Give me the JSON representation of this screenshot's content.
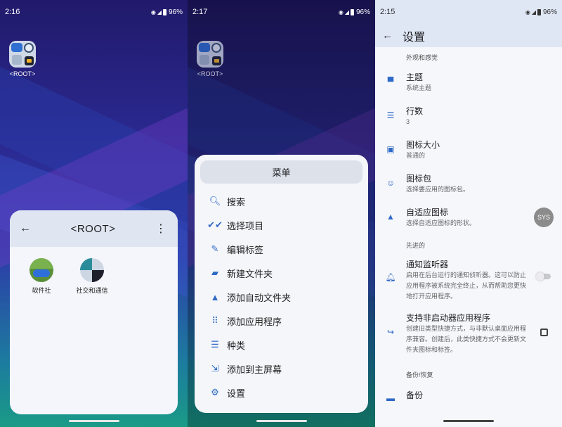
{
  "screens": [
    {
      "status": {
        "time": "2:16",
        "battery": "96%"
      },
      "desktop_app": {
        "label": "<ROOT>"
      },
      "folder": {
        "title": "<ROOT>",
        "apps": [
          {
            "label": "软件社"
          },
          {
            "label": "社交和通信"
          }
        ]
      }
    },
    {
      "status": {
        "time": "2:17",
        "battery": "96%"
      },
      "desktop_app": {
        "label": "<ROOT>"
      },
      "menu": {
        "header": "菜单",
        "items": [
          {
            "label": "搜索",
            "icon": "search-icon"
          },
          {
            "label": "选择项目",
            "icon": "double-check-icon"
          },
          {
            "label": "编辑标签",
            "icon": "pencil-icon"
          },
          {
            "label": "新建文件夹",
            "icon": "new-folder-icon"
          },
          {
            "label": "添加自动文件夹",
            "icon": "shapes-icon"
          },
          {
            "label": "添加应用程序",
            "icon": "grid-icon"
          },
          {
            "label": "种类",
            "icon": "sort-icon"
          },
          {
            "label": "添加到主屏幕",
            "icon": "add-to-home-icon"
          },
          {
            "label": "设置",
            "icon": "gear-icon"
          }
        ]
      }
    },
    {
      "status": {
        "time": "2:15",
        "battery": "96%"
      },
      "title": "设置",
      "sections": [
        {
          "header": "外观和感觉",
          "items": [
            {
              "title": "主题",
              "subtitle": "系统主题",
              "icon": "paint-roller-icon"
            },
            {
              "title": "行数",
              "subtitle": "3",
              "icon": "list-icon"
            },
            {
              "title": "图标大小",
              "subtitle": "普通的",
              "icon": "image-size-icon"
            },
            {
              "title": "图标包",
              "subtitle": "选择要应用的图标包。",
              "icon": "smiley-icon"
            },
            {
              "title": "自适应图标",
              "subtitle": "选择自适应图标的形状。",
              "icon": "shapes-icon",
              "chip": "SYS"
            }
          ]
        },
        {
          "header": "先进的",
          "items": [
            {
              "title": "通知监听器",
              "subtitle": "启用在后台运行的通知侦听器。这可以防止应用程序被系统完全终止，从而帮助您更快地打开应用程序。",
              "icon": "bell-icon",
              "control": "toggle",
              "value": false
            },
            {
              "title": "支持非启动器应用程序",
              "subtitle": "创建旧类型快捷方式，与非默认桌面应用程序兼容。创建后，此类快捷方式不会更新文件夹图标和标签。",
              "icon": "share-arrow-icon",
              "control": "checkbox",
              "value": false
            }
          ]
        },
        {
          "header": "备份/恢复",
          "items": [
            {
              "title": "备份",
              "subtitle": "",
              "icon": "backup-icon"
            }
          ]
        }
      ]
    }
  ]
}
